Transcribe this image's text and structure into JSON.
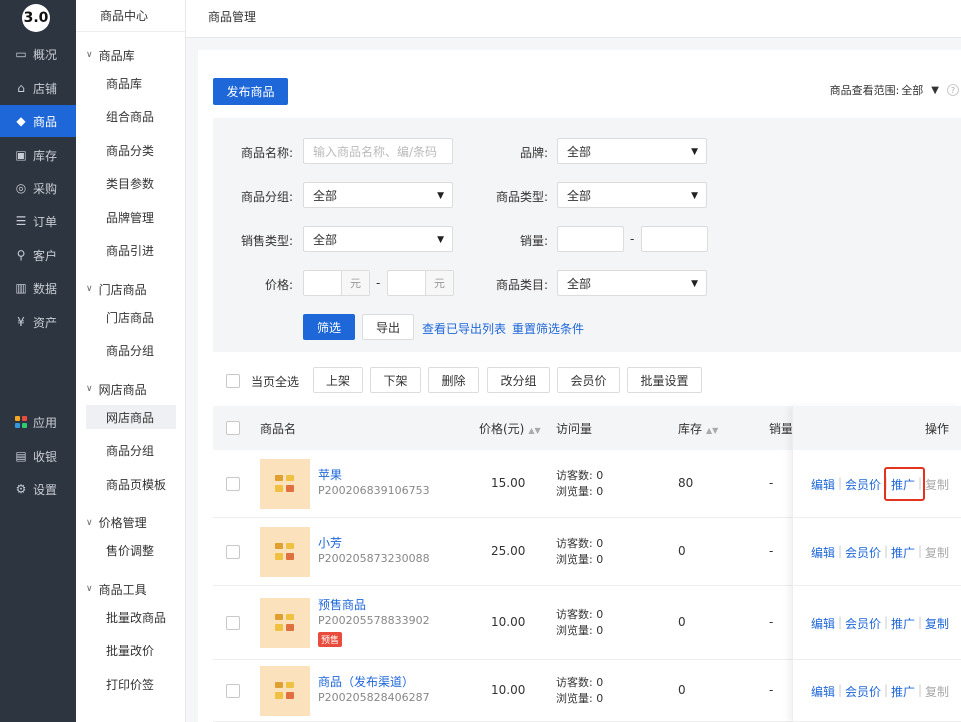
{
  "logo": "3.0",
  "nav": [
    {
      "label": "概况",
      "icon": "monitor-icon"
    },
    {
      "label": "店铺",
      "icon": "store-icon"
    },
    {
      "label": "商品",
      "icon": "tag-icon",
      "active": true
    },
    {
      "label": "库存",
      "icon": "warehouse-icon"
    },
    {
      "label": "采购",
      "icon": "purchase-icon"
    },
    {
      "label": "订单",
      "icon": "order-icon"
    },
    {
      "label": "客户",
      "icon": "user-icon"
    },
    {
      "label": "数据",
      "icon": "chart-icon"
    },
    {
      "label": "资产",
      "icon": "asset-icon"
    },
    {
      "label": "应用",
      "icon": "apps-icon"
    },
    {
      "label": "收银",
      "icon": "cashier-icon"
    },
    {
      "label": "设置",
      "icon": "gear-icon"
    }
  ],
  "sidebar": {
    "title": "商品中心",
    "groups": [
      {
        "label": "商品库",
        "items": [
          "商品库",
          "组合商品",
          "商品分类",
          "类目参数",
          "品牌管理",
          "商品引进"
        ]
      },
      {
        "label": "门店商品",
        "items": [
          "门店商品",
          "商品分组"
        ]
      },
      {
        "label": "网店商品",
        "items": [
          "网店商品",
          "商品分组",
          "商品页模板"
        ]
      },
      {
        "label": "价格管理",
        "items": [
          "售价调整"
        ]
      },
      {
        "label": "商品工具",
        "items": [
          "批量改商品",
          "批量改价",
          "打印价签"
        ]
      }
    ]
  },
  "header": {
    "title": "商品管理"
  },
  "toolbar": {
    "publish_label": "发布商品",
    "scope_label": "商品查看范围:",
    "scope_value": "全部"
  },
  "filter": {
    "name_label": "商品名称:",
    "name_placeholder": "输入商品名称、编/条码",
    "brand_label": "品牌:",
    "brand_value": "全部",
    "group_label": "商品分组:",
    "group_value": "全部",
    "type_label": "商品类型:",
    "type_value": "全部",
    "sale_type_label": "销售类型:",
    "sale_type_value": "全部",
    "sales_label": "销量:",
    "price_label": "价格:",
    "price_unit": "元",
    "category_label": "商品类目:",
    "category_value": "全部",
    "dash": "-",
    "submit_label": "筛选",
    "export_label": "导出",
    "view_exports_label": "查看已导出列表",
    "reset_label": "重置筛选条件"
  },
  "bulk": {
    "select_all_label": "当页全选",
    "actions": [
      "上架",
      "下架",
      "删除",
      "改分组",
      "会员价",
      "批量设置"
    ]
  },
  "table": {
    "columns": [
      "商品名",
      "价格(元)",
      "访问量",
      "库存",
      "销量",
      "操作"
    ],
    "visitor_label": "访客数:",
    "view_label": "浏览量:",
    "rows": [
      {
        "name": "苹果",
        "code": "P200206839106753",
        "price": "15.00",
        "visitors": "0",
        "views": "0",
        "stock": "80",
        "sales": "-",
        "tag": "",
        "copy_enabled": false,
        "highlight_promote": true
      },
      {
        "name": "小芳",
        "code": "P200205873230088",
        "price": "25.00",
        "visitors": "0",
        "views": "0",
        "stock": "0",
        "sales": "-",
        "tag": "",
        "copy_enabled": false,
        "highlight_promote": false
      },
      {
        "name": "预售商品",
        "code": "P200205578833902",
        "price": "10.00",
        "visitors": "0",
        "views": "0",
        "stock": "0",
        "sales": "-",
        "tag": "预售",
        "copy_enabled": true,
        "highlight_promote": false
      },
      {
        "name": "商品（发布渠道）",
        "code": "P200205828406287",
        "price": "10.00",
        "visitors": "0",
        "views": "0",
        "stock": "0",
        "sales": "-",
        "tag": "",
        "copy_enabled": false,
        "highlight_promote": false
      }
    ],
    "ops": [
      "编辑",
      "会员价",
      "推广",
      "复制"
    ]
  },
  "colors": {
    "primary": "#1e67d8",
    "nav_bg": "#2d3541",
    "highlight": "#e0341f",
    "tag": "#e74c3c",
    "thumb_bg": "#fbe2bd"
  }
}
